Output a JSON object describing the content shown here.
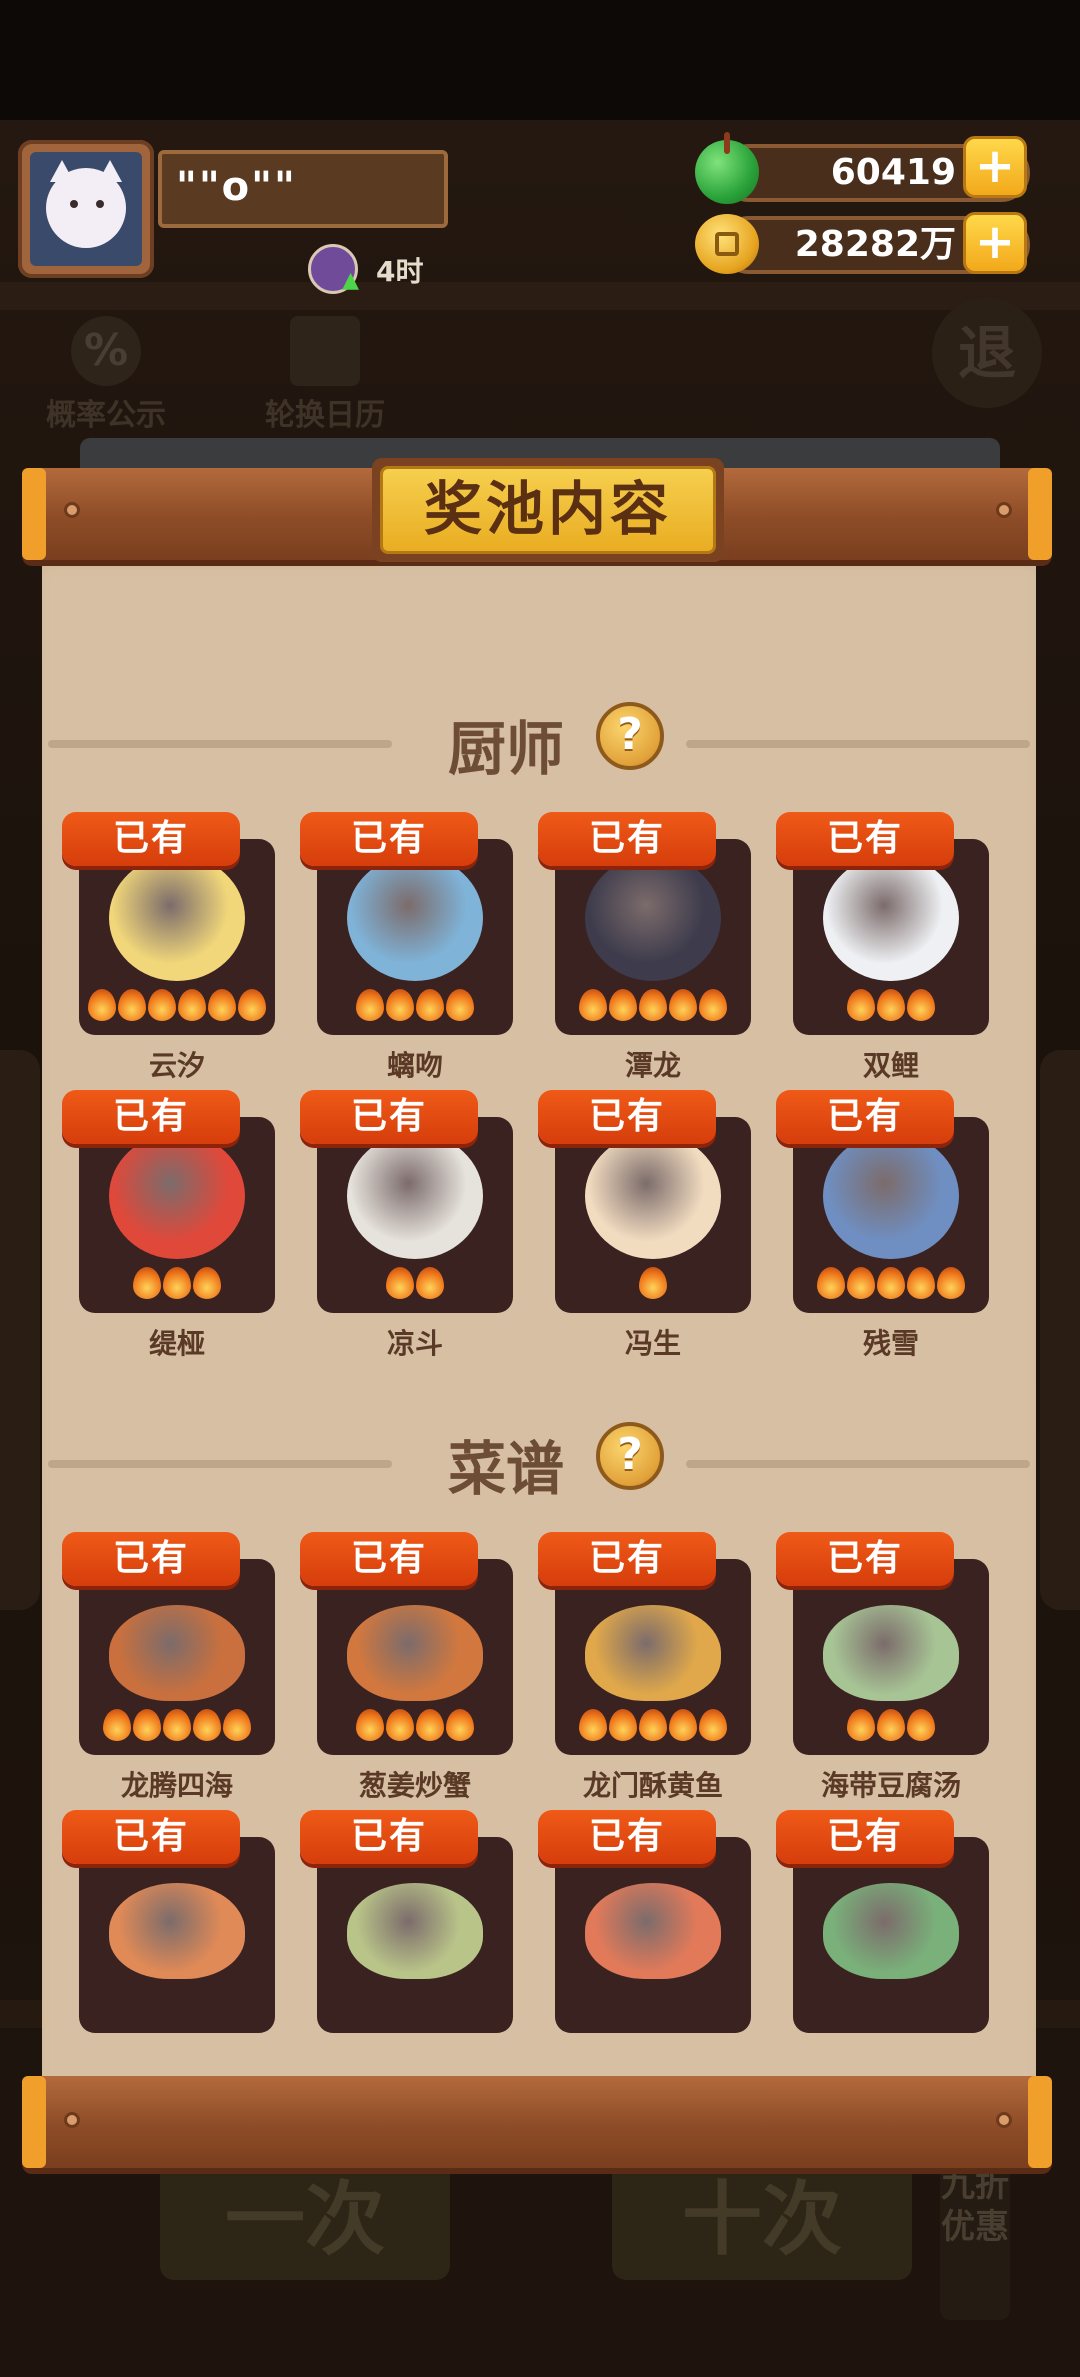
{
  "top_bar": {
    "player_name": "\"\"o\"\"",
    "time_text": "4时",
    "jade_amount": "60419",
    "coin_amount": "28282万",
    "plus_label": "+"
  },
  "background": {
    "tool1_icon": "%",
    "tool1_label": "概率公示",
    "tool2_label": "轮换日历",
    "exit_label": "退",
    "btn_one": "一次",
    "btn_ten": "十次",
    "tag_text": "九折优惠"
  },
  "panel": {
    "title": "奖池内容",
    "sections": [
      {
        "title": "厨师",
        "help_icon": "?"
      },
      {
        "title": "菜谱",
        "help_icon": "?"
      }
    ],
    "owned_label": "已有",
    "chefs": [
      {
        "name": "云汐",
        "stars": 6
      },
      {
        "name": "螭吻",
        "stars": 4
      },
      {
        "name": "潭龙",
        "stars": 5
      },
      {
        "name": "双鲤",
        "stars": 3
      },
      {
        "name": "缇桠",
        "stars": 3
      },
      {
        "name": "凉斗",
        "stars": 2
      },
      {
        "name": "冯生",
        "stars": 1
      },
      {
        "name": "残雪",
        "stars": 5
      }
    ],
    "recipes": [
      {
        "name": "龙腾四海",
        "stars": 5
      },
      {
        "name": "葱姜炒蟹",
        "stars": 4
      },
      {
        "name": "龙门酥黄鱼",
        "stars": 5
      },
      {
        "name": "海带豆腐汤",
        "stars": 3
      },
      {
        "name": "",
        "stars": 0
      },
      {
        "name": "",
        "stars": 0
      },
      {
        "name": "",
        "stars": 0
      },
      {
        "name": "",
        "stars": 0
      }
    ]
  },
  "colors": {
    "owned_badge": "#e4480f",
    "card_bg": "#3a2221",
    "paper": "#d7bfa3",
    "title_gold": "#f0bf38"
  }
}
